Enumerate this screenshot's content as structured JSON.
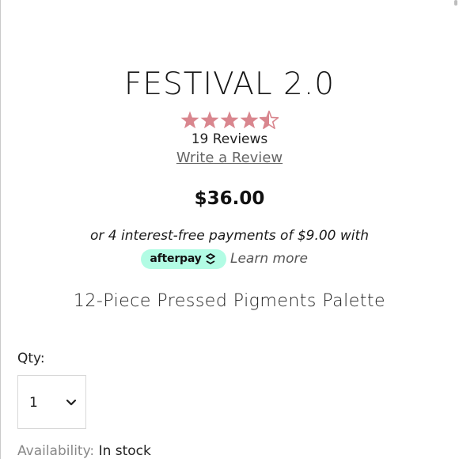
{
  "product": {
    "title": "FESTIVAL 2.0",
    "rating": 4.5,
    "rating_max": 5,
    "star_color": "#d9868e",
    "reviews_count": "19 Reviews",
    "write_review": "Write a Review",
    "price": "$36.00",
    "subtitle": "12-Piece Pressed Pigments Palette"
  },
  "afterpay": {
    "line": "or 4 interest-free payments of $9.00 with",
    "badge": "afterpay",
    "badge_color": "#b2fce4",
    "learn_more": "Learn more",
    "icon": "afterpay-arrows-icon"
  },
  "quantity": {
    "label": "Qty:",
    "value": "1",
    "icon": "chevron-down-icon"
  },
  "availability": {
    "label": "Availability:",
    "value": "In stock"
  }
}
